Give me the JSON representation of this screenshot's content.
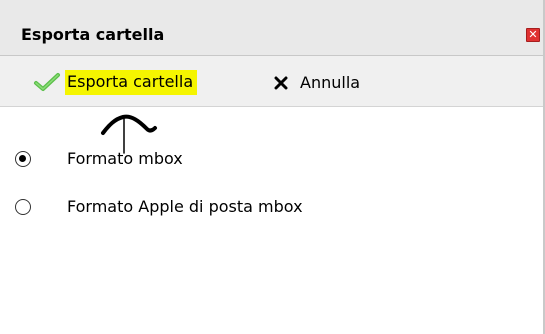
{
  "dialog": {
    "title": "Esporta cartella",
    "close_icon": "close-icon"
  },
  "toolbar": {
    "export_label": "Esporta cartella",
    "export_icon": "checkmark-icon",
    "export_highlight_color": "#f5f500",
    "cancel_label": "Annulla",
    "cancel_icon": "x-icon"
  },
  "annotation": {
    "icon": "hand-drawn-arrow-icon"
  },
  "options": [
    {
      "label": "Formato mbox",
      "selected": true
    },
    {
      "label": "Formato Apple di posta mbox",
      "selected": false
    }
  ],
  "colors": {
    "check_green": "#4caf50",
    "close_red": "#e03131"
  }
}
